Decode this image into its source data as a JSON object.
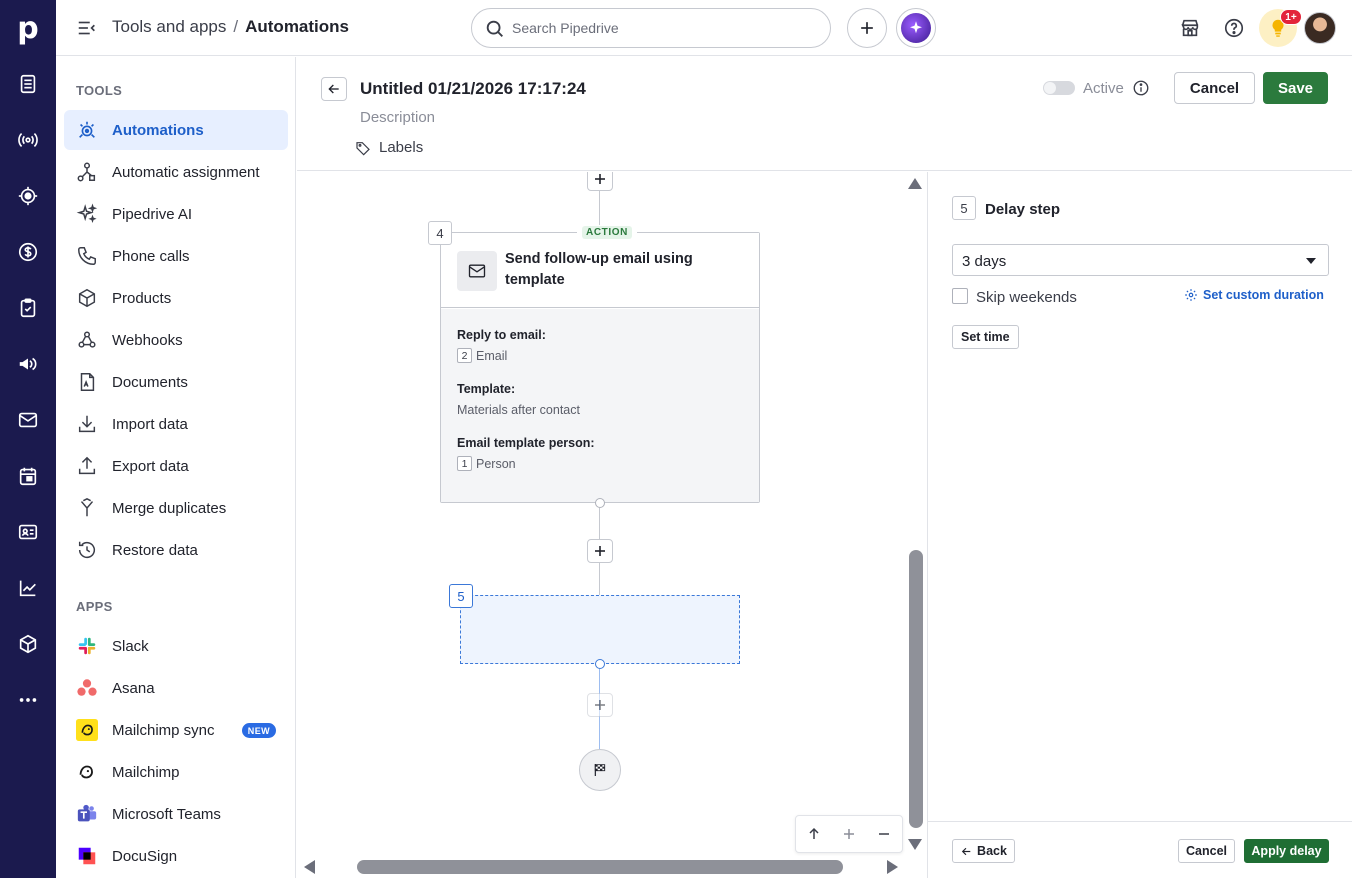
{
  "rail": {
    "logo": "p",
    "items": [
      "deals-icon",
      "leads-icon",
      "contacts-target-icon",
      "money-icon",
      "activities-icon",
      "campaigns-icon",
      "mail-icon",
      "calendar-icon",
      "contacts-card-icon",
      "insights-icon",
      "products-icon",
      "more-icon"
    ]
  },
  "header": {
    "breadcrumb_parent": "Tools and apps",
    "breadcrumb_sep": "/",
    "breadcrumb_current": "Automations",
    "search_placeholder": "Search Pipedrive",
    "notification_count": "1+"
  },
  "sidebar": {
    "tools_heading": "TOOLS",
    "tools": [
      {
        "label": "Automations",
        "icon": "automations-icon",
        "active": true
      },
      {
        "label": "Automatic assignment",
        "icon": "assignment-icon"
      },
      {
        "label": "Pipedrive AI",
        "icon": "sparkle-icon"
      },
      {
        "label": "Phone calls",
        "icon": "phone-icon"
      },
      {
        "label": "Products",
        "icon": "box-icon"
      },
      {
        "label": "Webhooks",
        "icon": "webhook-icon"
      },
      {
        "label": "Documents",
        "icon": "document-icon"
      },
      {
        "label": "Import data",
        "icon": "import-icon"
      },
      {
        "label": "Export data",
        "icon": "export-icon"
      },
      {
        "label": "Merge duplicates",
        "icon": "merge-icon"
      },
      {
        "label": "Restore data",
        "icon": "restore-icon"
      }
    ],
    "apps_heading": "APPS",
    "apps": [
      {
        "label": "Slack",
        "icon": "slack-icon"
      },
      {
        "label": "Asana",
        "icon": "asana-icon"
      },
      {
        "label": "Mailchimp sync",
        "icon": "mailchimp-icon",
        "badge": "NEW"
      },
      {
        "label": "Mailchimp",
        "icon": "mailchimp-icon"
      },
      {
        "label": "Microsoft Teams",
        "icon": "teams-icon"
      },
      {
        "label": "DocuSign",
        "icon": "docusign-icon"
      }
    ]
  },
  "automation": {
    "title": "Untitled 01/21/2026 17:17:24",
    "description_placeholder": "Description",
    "labels": "Labels",
    "active_label": "Active",
    "active": false,
    "cancel": "Cancel",
    "save": "Save"
  },
  "canvas": {
    "action_step_number": "4",
    "action_tag": "ACTION",
    "action_title": "Send follow-up email using template",
    "fields": [
      {
        "label": "Reply to email:",
        "chip": "2",
        "value": "Email"
      },
      {
        "label": "Template:",
        "chip": "",
        "value": "Materials after contact"
      },
      {
        "label": "Email template person:",
        "chip": "1",
        "value": "Person"
      }
    ],
    "placeholder_step_number": "5"
  },
  "panel": {
    "step_number": "5",
    "title": "Delay step",
    "duration_value": "3 days",
    "skip_weekends_label": "Skip weekends",
    "skip_weekends": false,
    "custom_duration_link": "Set custom duration",
    "set_time_label": "Set time",
    "back_label": "Back",
    "cancel_label": "Cancel",
    "apply_label": "Apply delay"
  },
  "colors": {
    "rail_bg": "#1b1a4e",
    "accent_blue": "#1e5fc9",
    "save_green": "#2b7a3d",
    "apply_green": "#1f6e34",
    "active_item_bg": "#e7efff"
  }
}
